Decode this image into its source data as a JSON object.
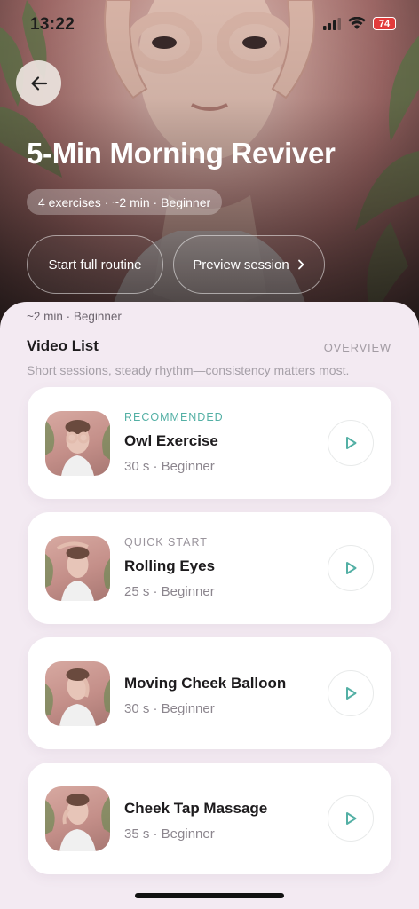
{
  "status_bar": {
    "time": "13:22",
    "battery": "74"
  },
  "hero": {
    "title": "5-Min Morning Reviver",
    "meta": "4 exercises · ~2 min · Beginner",
    "start_button": "Start full routine",
    "preview_button": "Preview session"
  },
  "sheet": {
    "meta": "~2 min · Beginner",
    "list_title": "Video List",
    "overview": "OVERVIEW",
    "subtitle": "Short sessions, steady rhythm—consistency matters most."
  },
  "exercises": [
    {
      "tag": "RECOMMENDED",
      "title": "Owl Exercise",
      "meta": "30 s · Beginner"
    },
    {
      "tag": "QUICK START",
      "title": "Rolling Eyes",
      "meta": "25 s · Beginner"
    },
    {
      "tag": "",
      "title": "Moving Cheek Balloon",
      "meta": "30 s · Beginner"
    },
    {
      "tag": "",
      "title": "Cheek Tap Massage",
      "meta": "35 s · Beginner"
    }
  ],
  "colors": {
    "accent": "#54b0a5",
    "sheet_bg": "#f3eaf2",
    "battery_low": "#e23b3b"
  },
  "icons": [
    "back-arrow-icon",
    "chevron-right-icon",
    "play-icon",
    "signal-icon",
    "wifi-icon",
    "battery-icon"
  ]
}
